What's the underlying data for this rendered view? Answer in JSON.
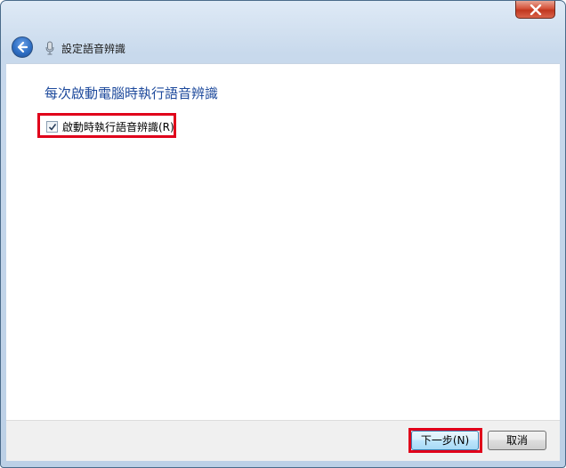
{
  "window": {
    "close_label": "x"
  },
  "nav": {
    "title": "設定語音辨識",
    "back_icon": "back-arrow-icon",
    "app_icon": "microphone-icon"
  },
  "content": {
    "heading": "每次啟動電腦時執行語音辨識",
    "checkbox": {
      "label": "啟動時執行語音辨識(R)",
      "checked": true
    }
  },
  "footer": {
    "next_label": "下一步(N)",
    "cancel_label": "取消"
  },
  "colors": {
    "heading": "#1e4a9c",
    "highlight": "#e0001a",
    "close_button": "#c0371f"
  }
}
